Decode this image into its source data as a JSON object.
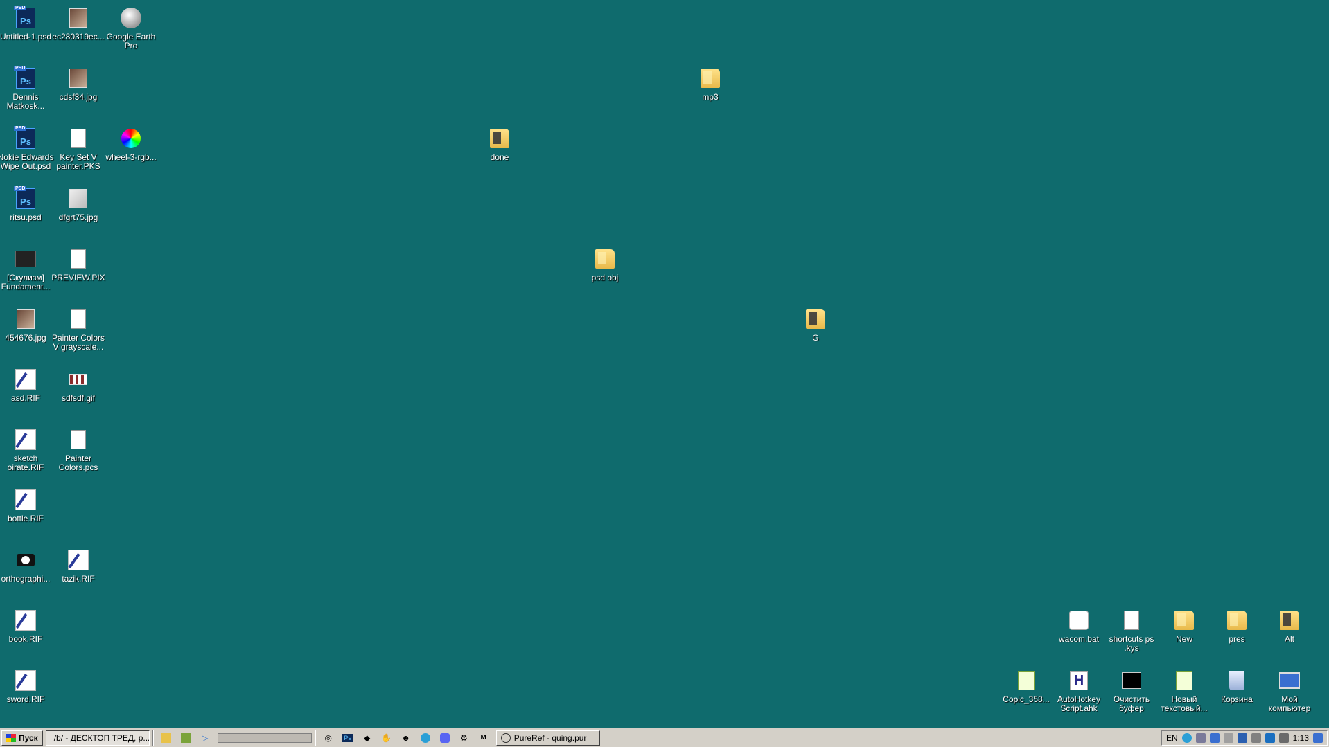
{
  "desktop": {
    "icons": [
      {
        "label": "Untitled-1.psd",
        "kind": "ps"
      },
      {
        "label": "ec280319ec...",
        "kind": "img"
      },
      {
        "label": "Google Earth Pro",
        "kind": "globe"
      },
      {
        "label": "Dennis Matkosk...",
        "kind": "ps"
      },
      {
        "label": "cdsf34.jpg",
        "kind": "img"
      },
      {
        "label": "Nokie Edwards Wipe Out.psd",
        "kind": "ps"
      },
      {
        "label": "Key Set V painter.PKS",
        "kind": "doc"
      },
      {
        "label": "wheel-3-rgb...",
        "kind": "wheel"
      },
      {
        "label": "ritsu.psd",
        "kind": "ps"
      },
      {
        "label": "dfgrt75.jpg",
        "kind": "img"
      },
      {
        "label": "[Скулизм] Fundament...",
        "kind": "dark-thumb"
      },
      {
        "label": "PREVIEW.PIX",
        "kind": "doc"
      },
      {
        "label": "454676.jpg",
        "kind": "img"
      },
      {
        "label": "Painter Colors V grayscale...",
        "kind": "doc"
      },
      {
        "label": "asd.RIF",
        "kind": "rif"
      },
      {
        "label": "sdfsdf.gif",
        "kind": "img"
      },
      {
        "label": "sketch oirate.RIF",
        "kind": "rif"
      },
      {
        "label": "Painter Colors.pcs",
        "kind": "doc"
      },
      {
        "label": "bottle.RIF",
        "kind": "rif"
      },
      {
        "label": "orthographi...",
        "kind": "blackbox"
      },
      {
        "label": "tazik.RIF",
        "kind": "rif"
      },
      {
        "label": "book.RIF",
        "kind": "rif"
      },
      {
        "label": "sword.RIF",
        "kind": "rif"
      },
      {
        "label": "done",
        "kind": "folder-dark"
      },
      {
        "label": "mp3",
        "kind": "folder"
      },
      {
        "label": "psd obj",
        "kind": "folder"
      },
      {
        "label": "G",
        "kind": "folder-dark"
      },
      {
        "label": "wacom.bat",
        "kind": "gear"
      },
      {
        "label": "shortcuts ps .kys",
        "kind": "doc"
      },
      {
        "label": "New",
        "kind": "folder"
      },
      {
        "label": "pres",
        "kind": "folder"
      },
      {
        "label": "Alt",
        "kind": "folder-dark"
      },
      {
        "label": "Copic_358...",
        "kind": "txt"
      },
      {
        "label": "AutoHotkey Script.ahk",
        "kind": "ahk"
      },
      {
        "label": "Очистить буфер",
        "kind": "cmd"
      },
      {
        "label": "Новый текстовый...",
        "kind": "txt"
      },
      {
        "label": "Корзина",
        "kind": "trash"
      },
      {
        "label": "Мой компьютер",
        "kind": "pc"
      }
    ]
  },
  "taskbar": {
    "start_label": "Пуск",
    "tasks": [
      {
        "label": "/b/ - ДЕСКТОП ТРЕД, р...",
        "active": true
      },
      {
        "label": "PureRef - quing.pur",
        "active": false
      }
    ],
    "quicklaunch_ps": "Ps",
    "tray": {
      "language": "EN",
      "time": "1:13"
    }
  }
}
